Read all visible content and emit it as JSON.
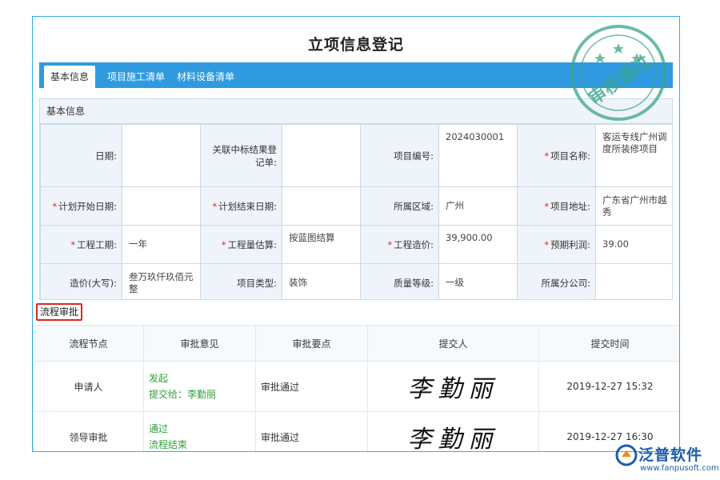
{
  "page_title": "立项信息登记",
  "tabs": [
    {
      "label": "基本信息",
      "active": true
    },
    {
      "label": "项目施工清单",
      "active": false
    },
    {
      "label": "材料设备清单",
      "active": false
    }
  ],
  "section_title": "基本信息",
  "form": {
    "date_label": "日期:",
    "date_value": "",
    "bid_label": "关联中标结果登记单:",
    "bid_value": "",
    "code_label": "项目编号:",
    "code_value": "2024030001",
    "name_label": "项目名称:",
    "name_value": "客运专线广州调度所装修项目",
    "plan_start_label": "计划开始日期:",
    "plan_start_value": "",
    "plan_end_label": "计划结束日期:",
    "plan_end_value": "",
    "region_label": "所属区域:",
    "region_value": "广州",
    "address_label": "项目地址:",
    "address_value": "广东省广州市越秀",
    "period_label": "工程工期:",
    "period_value": "一年",
    "estimate_label": "工程量估算:",
    "estimate_value": "按蓝图结算",
    "cost_label": "工程造价:",
    "cost_value": "39,900.00",
    "profit_label": "预期利润:",
    "profit_value": "39.00",
    "cost_caps_label": "造价(大写):",
    "cost_caps_value": "叁万玖仟玖佰元整",
    "type_label": "项目类型:",
    "type_value": "装饰",
    "quality_label": "质量等级:",
    "quality_value": "一级",
    "company_label": "所属分公司:",
    "company_value": ""
  },
  "flow": {
    "title": "流程审批",
    "headers": [
      "流程节点",
      "审批意见",
      "审批要点",
      "提交人",
      "提交时间"
    ],
    "rows": [
      {
        "node": "申请人",
        "opinion_1": "发起",
        "opinion_2": "提交给：李勤丽",
        "point": "审批通过",
        "signer": "李勤丽",
        "time": "2019-12-27 15:32"
      },
      {
        "node": "领导审批",
        "opinion_1": "通过",
        "opinion_2": "流程结束",
        "point": "审批通过",
        "signer": "李勤丽",
        "time": "2019-12-27 16:30"
      }
    ]
  },
  "stamp_text": "审核通过",
  "brand": {
    "name": "泛普软件",
    "url": "www.fanpusoft.com"
  },
  "colors": {
    "accent": "#2f9ae0",
    "required": "#e02424",
    "opinion": "#2e9e3a",
    "stamp": "#3aa58a",
    "brand": "#1f5ea8"
  }
}
